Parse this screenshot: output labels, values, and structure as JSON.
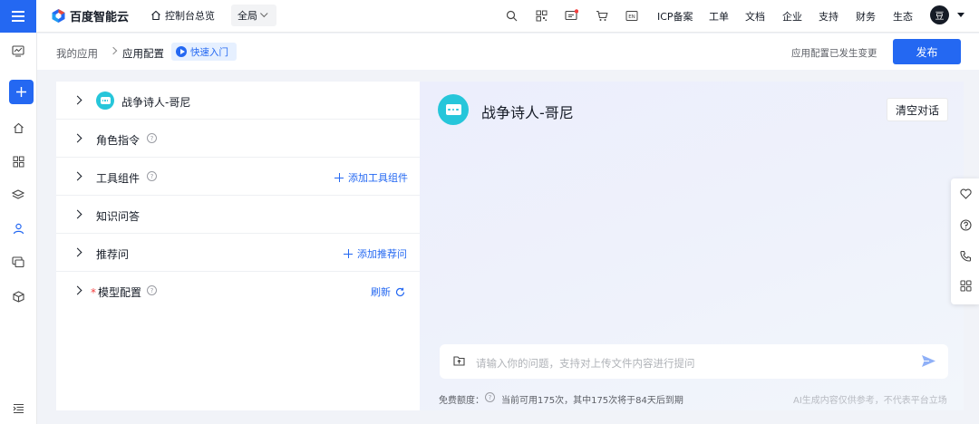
{
  "topbar": {
    "logo_text": "百度智能云",
    "console_label": "控制台总览",
    "region_label": "全局",
    "nav": [
      "ICP备案",
      "工单",
      "文档",
      "企业",
      "支持",
      "财务",
      "生态"
    ],
    "avatar_letter": "豆",
    "icons": [
      "search-icon",
      "qrcode-icon",
      "message-icon",
      "cart-icon",
      "en-language-icon"
    ]
  },
  "siderail": {
    "icons": [
      "monitor-icon",
      "add-icon",
      "home-icon",
      "grid-icon",
      "layers-icon",
      "user-icon",
      "screens-icon",
      "box-icon",
      "collapse-icon"
    ]
  },
  "header": {
    "crumb_root": "我的应用",
    "crumb_current": "应用配置",
    "quickstart_label": "快速入门",
    "change_status": "应用配置已发生变更",
    "publish_label": "发布"
  },
  "config": {
    "app_name": "战争诗人-哥尼",
    "role_label": "角色指令",
    "tools_label": "工具组件",
    "add_tool_label": "添加工具组件",
    "knowledge_label": "知识问答",
    "recommend_label": "推荐问",
    "add_recommend_label": "添加推荐问",
    "model_label": "模型配置",
    "refresh_label": "刷新"
  },
  "preview": {
    "title": "战争诗人-哥尼",
    "clear_label": "清空对话",
    "input_placeholder": "请输入你的问题，支持对上传文件内容进行提问",
    "quota_label": "免费额度：",
    "quota_text": "当前可用175次，其中175次将于84天后到期",
    "disclaimer": "AI生成内容仅供参考，不代表平台立场"
  },
  "colors": {
    "accent": "#2468f2",
    "bot_avatar": "#26c6da",
    "required": "#f33e3e"
  }
}
